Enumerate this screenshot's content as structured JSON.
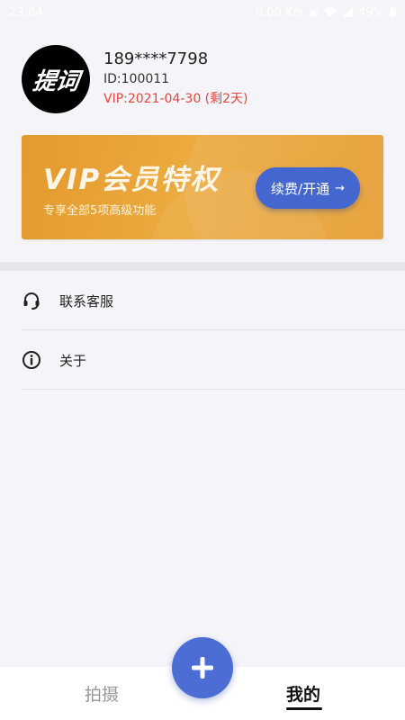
{
  "status_bar": {
    "time": "23:04",
    "speed": "0.00 K/s",
    "battery": "49%"
  },
  "profile": {
    "avatar_text": "提词",
    "phone": "189****7798",
    "uid": "ID:100011",
    "vip_line": "VIP:2021-04-30 (剩2天)"
  },
  "banner": {
    "title": "VIP会员特权",
    "subtitle": "专享全部5项高级功能",
    "button_label": "续费/开通",
    "button_arrow": "→"
  },
  "menu": {
    "items": [
      {
        "label": "联系客服",
        "icon": "headset-icon"
      },
      {
        "label": "关于",
        "icon": "info-icon"
      }
    ]
  },
  "bottom_nav": {
    "tabs": [
      {
        "label": "拍摄",
        "active": false
      },
      {
        "label": "我的",
        "active": true
      }
    ],
    "fab_icon": "plus-icon"
  },
  "colors": {
    "accent_blue": "#4b6dd4",
    "vip_red": "#e8453c",
    "banner_orange": "#e8a236"
  }
}
